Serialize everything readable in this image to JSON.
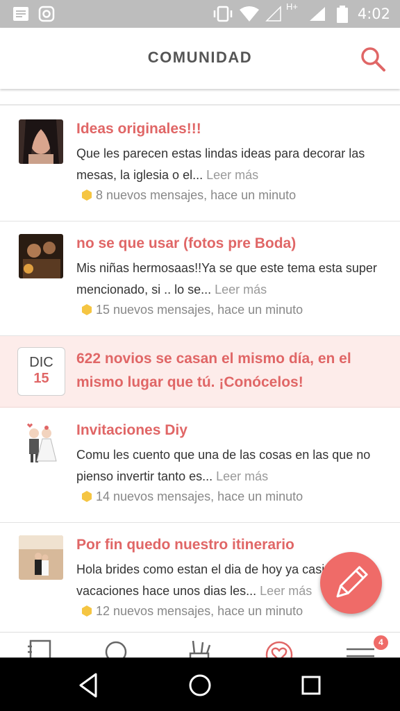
{
  "status_bar": {
    "time": "4:02",
    "network_label": "H+",
    "icons": [
      "notification-icon",
      "instagram-icon",
      "vibrate-icon",
      "wifi-icon",
      "signal-icon",
      "battery-icon"
    ]
  },
  "header": {
    "title": "COMUNIDAD",
    "search_icon": "search-icon"
  },
  "posts": [
    {
      "title": "Ideas originales!!!",
      "excerpt": "Que les parecen estas lindas ideas para decorar las mesas, la iglesia o el...",
      "read_more": "Leer más",
      "meta": "8 nuevos mensajes, hace un minuto"
    },
    {
      "title": "no se que usar (fotos pre Boda)",
      "excerpt": "Mis niñas hermosaas!!Ya se que este tema esta super mencionado, si .. lo se...",
      "read_more": "Leer más",
      "meta": "15 nuevos mensajes, hace un minuto"
    },
    {
      "title": "Invitaciones Diy",
      "excerpt": "Comu les cuento que una de las cosas en las que no pienso invertir tanto es...",
      "read_more": "Leer más",
      "meta": "14 nuevos mensajes, hace un minuto"
    },
    {
      "title": "Por fin quedo nuestro itinerario",
      "excerpt": "Hola brides como estan el dia de hoy ya casi vacaciones hace unos dias les...",
      "read_more": "Leer más",
      "meta": "12 nuevos mensajes, hace un minuto"
    }
  ],
  "promo": {
    "month": "DIC",
    "day": "15",
    "text": "622 novios se casan el mismo día, en el mismo lugar que tú. ¡Conócelos!"
  },
  "fab": {
    "icon": "pencil-icon"
  },
  "tab_bar": {
    "icons": [
      "notebook-icon",
      "chat-icon",
      "vendors-icon",
      "community-heart-icon",
      "menu-icon"
    ],
    "menu_badge": "4"
  },
  "colors": {
    "accent": "#e06666",
    "fab": "#ef6b68",
    "promo_bg": "#fdecea",
    "badge_hex": "#f5c542"
  }
}
